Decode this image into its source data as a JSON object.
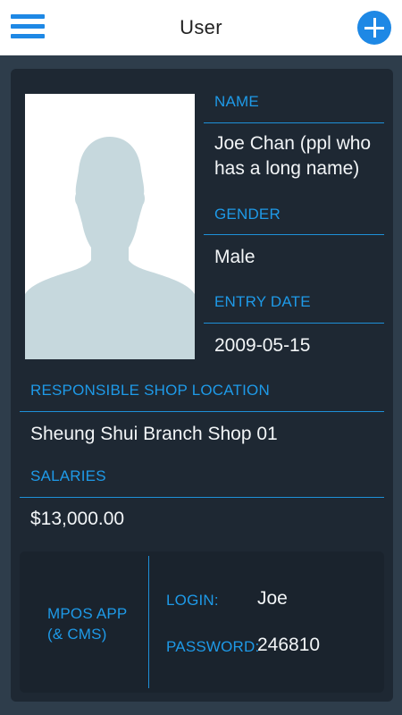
{
  "header": {
    "title": "User",
    "menu_icon": "hamburger-menu-icon",
    "add_icon": "plus-circle-icon",
    "accent": "#1e88e5"
  },
  "profile": {
    "photo_icon": "user-silhouette-icon",
    "name_label": "NAME",
    "name_value_line1": "Joe Chan (ppl who",
    "name_value_line2": "has a long name)",
    "gender_label": "GENDER",
    "gender_value": "Male",
    "entry_date_label": "ENTRY DATE",
    "entry_date_value": "2009-05-15",
    "shop_label": "RESPONSIBLE SHOP LOCATION",
    "shop_value": "Sheung Shui Branch Shop 01",
    "salaries_label": "SALARIES",
    "salaries_value": "$13,000.00"
  },
  "mpos": {
    "app_label_line1": "MPOS APP",
    "app_label_line2": "(& CMS)",
    "login_label": "LOGIN:",
    "login_value": "Joe",
    "password_label": "PASSWORD:",
    "password_value": "246810"
  },
  "colors": {
    "background": "#2e3d4b",
    "card": "#1e2833",
    "label": "#1e9ae8",
    "value": "#f2f5f7"
  }
}
